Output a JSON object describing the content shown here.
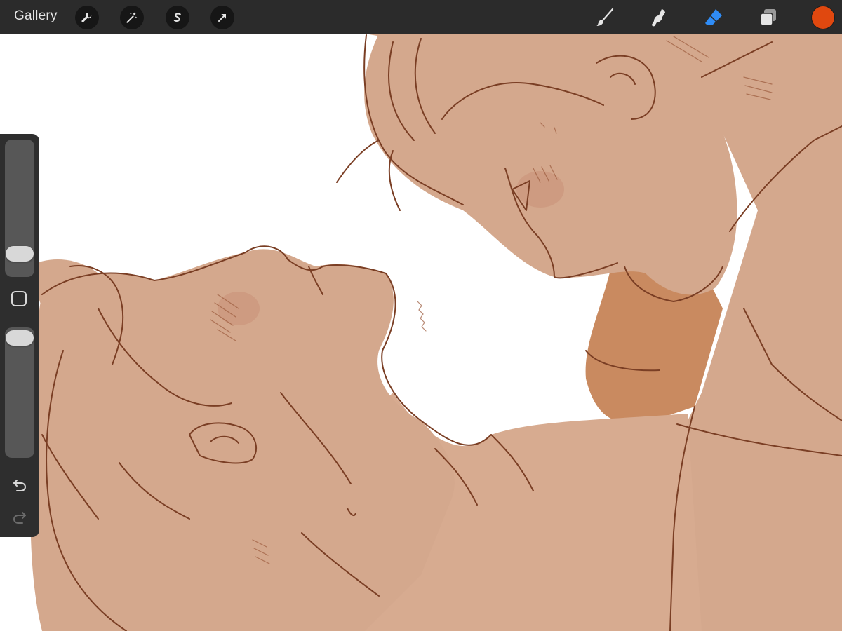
{
  "toolbar": {
    "gallery_label": "Gallery",
    "left_tools": [
      {
        "icon": "wrench-icon",
        "name": "actions"
      },
      {
        "icon": "magic-wand-icon",
        "name": "adjustments"
      },
      {
        "icon": "selection-icon",
        "name": "selection"
      },
      {
        "icon": "transform-arrow-icon",
        "name": "transform"
      }
    ],
    "right_tools": [
      {
        "icon": "brush-icon",
        "name": "paint",
        "active": false
      },
      {
        "icon": "smudge-icon",
        "name": "smudge",
        "active": false
      },
      {
        "icon": "eraser-icon",
        "name": "erase",
        "active": true
      },
      {
        "icon": "layers-icon",
        "name": "layers",
        "active": false
      }
    ],
    "current_color": "#e0480f"
  },
  "sidebar": {
    "brush_size_icon": "brush-size-slider",
    "opacity_icon": "opacity-slider",
    "modify_icon": "square-icon",
    "undo_icon": "undo-icon",
    "redo_icon": "redo-icon",
    "brush_size_level": 0.12,
    "opacity_level": 0.98
  },
  "colors": {
    "toolbar_bg": "#2b2b2b",
    "sidebar_bg": "#2e2e2e",
    "active_tool": "#2f8cf6",
    "canvas_bg": "#ffffff",
    "skin": "#d4a88d",
    "line": "#7a3e24"
  }
}
